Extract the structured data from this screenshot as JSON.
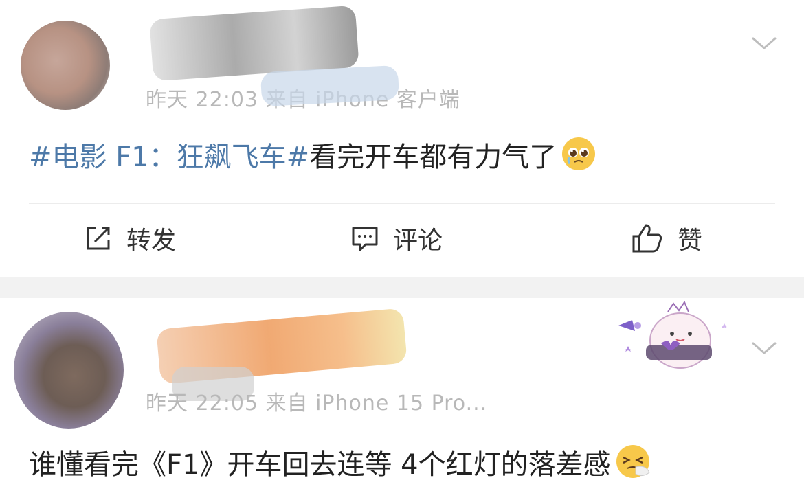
{
  "posts": [
    {
      "meta": "昨天 22:03 来自 iPhone 客户端",
      "hashtag": "#电影 F1：狂飙飞车#",
      "text": "看完开车都有力气了",
      "emoji_icon": "pleading-face-emoji",
      "actions": {
        "repost": "转发",
        "comment": "评论",
        "like": "赞"
      }
    },
    {
      "meta": "昨天 22:05 来自 iPhone 15 Pro...",
      "text": "谁懂看完《F1》开车回去连等 4个红灯的落差感",
      "emoji_icon": "sneezing-face-emoji",
      "sticker_icon": "bunny-doll-sticker"
    }
  ],
  "colors": {
    "hashtag": "#4d79a8",
    "meta": "#b8b8b8",
    "separator": "#f2f2f2"
  }
}
